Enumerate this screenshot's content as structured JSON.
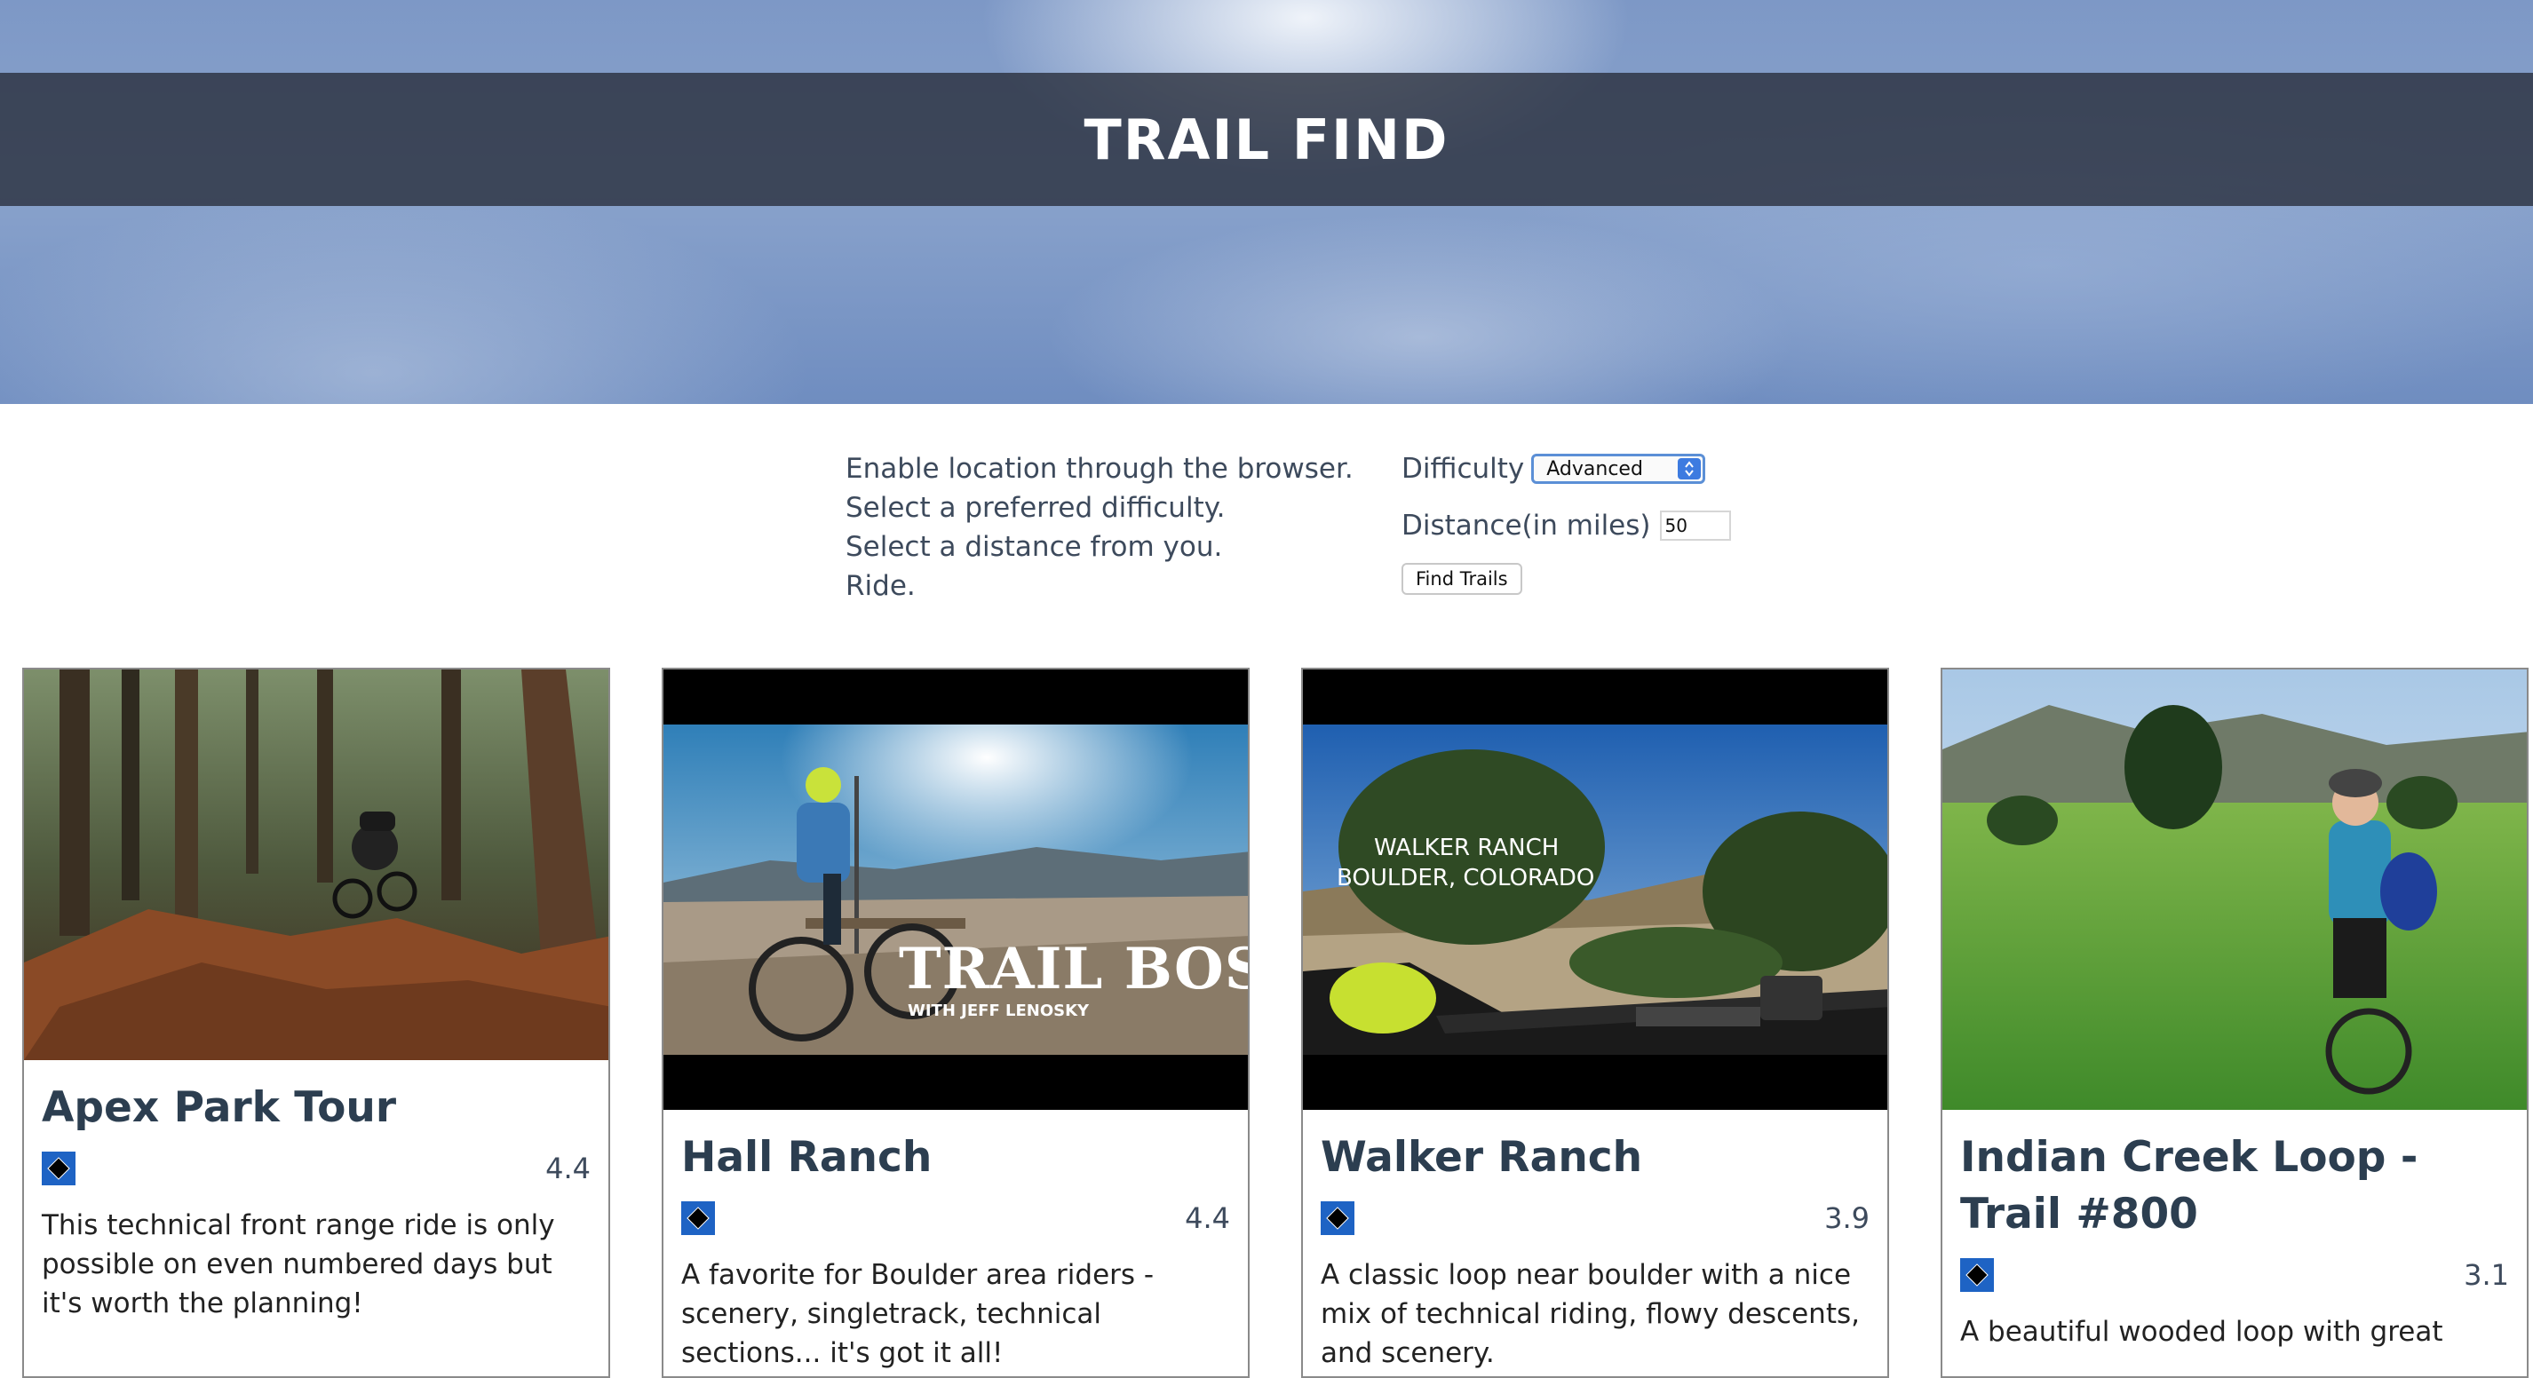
{
  "header": {
    "title": "TRAIL FIND"
  },
  "intro": {
    "lines": [
      "Enable location through the browser.",
      "Select a preferred difficulty.",
      "Select a distance from you.",
      "Ride."
    ]
  },
  "form": {
    "difficulty_label": "Difficulty",
    "difficulty_value": "Advanced",
    "distance_label": "Distance(in miles)",
    "distance_value": "50",
    "submit_label": "Find Trails"
  },
  "colors": {
    "difficulty_icon": "#1e63c4",
    "title_band": "#262c38",
    "text": "#2c3e50"
  },
  "trails": [
    {
      "name": "Apex Park Tour",
      "rating": "4.4",
      "difficulty_icon": "black-diamond-icon",
      "summary": "This technical front range ride is only possible on even numbered days but it's worth the planning!"
    },
    {
      "name": "Hall Ranch",
      "rating": "4.4",
      "difficulty_icon": "black-diamond-icon",
      "summary": "A favorite for Boulder area riders - scenery, singletrack, technical sections... it's got it all!",
      "image_text": [
        "TRAIL BOSS",
        "WITH JEFF LENOSKY"
      ]
    },
    {
      "name": "Walker Ranch",
      "rating": "3.9",
      "difficulty_icon": "black-diamond-icon",
      "summary": "A classic loop near boulder with a nice mix of technical riding, flowy descents, and scenery.",
      "image_text": [
        "WALKER RANCH",
        "BOULDER, COLORADO"
      ]
    },
    {
      "name": "Indian Creek Loop - Trail #800",
      "rating": "3.1",
      "difficulty_icon": "black-diamond-icon",
      "summary": "A beautiful wooded loop with great"
    }
  ]
}
